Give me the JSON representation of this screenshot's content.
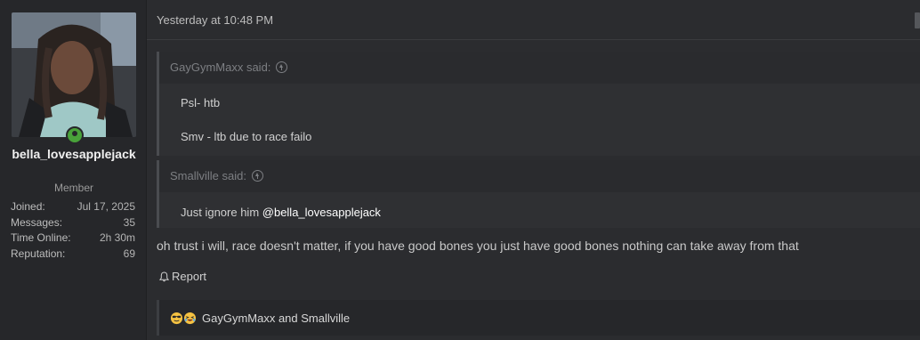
{
  "user": {
    "username": "bella_lovesapplejack",
    "role": "Member",
    "stats": [
      {
        "label": "Joined:",
        "value": "Jul 17, 2025"
      },
      {
        "label": "Messages:",
        "value": "35"
      },
      {
        "label": "Time Online:",
        "value": "2h 30m"
      },
      {
        "label": "Reputation:",
        "value": "69"
      }
    ],
    "status_color": "#49a23a"
  },
  "post": {
    "timestamp": "Yesterday at 10:48 PM",
    "quotes": [
      {
        "author": "GayGymMaxx said:",
        "lines": [
          "Psl- htb",
          "Smv - ltb due to race failo"
        ]
      },
      {
        "author": "Smallville said:",
        "text": "Just ignore him ",
        "mention": "@bella_lovesapplejack"
      }
    ],
    "message": "oh trust i will, race doesn't matter, if you have good bones you just have good bones nothing can take away from that",
    "report_label": "Report",
    "reactions_label": "GayGymMaxx and Smallville",
    "reaction_icons": [
      "cool-emoji-icon",
      "laughing-emoji-icon"
    ]
  }
}
